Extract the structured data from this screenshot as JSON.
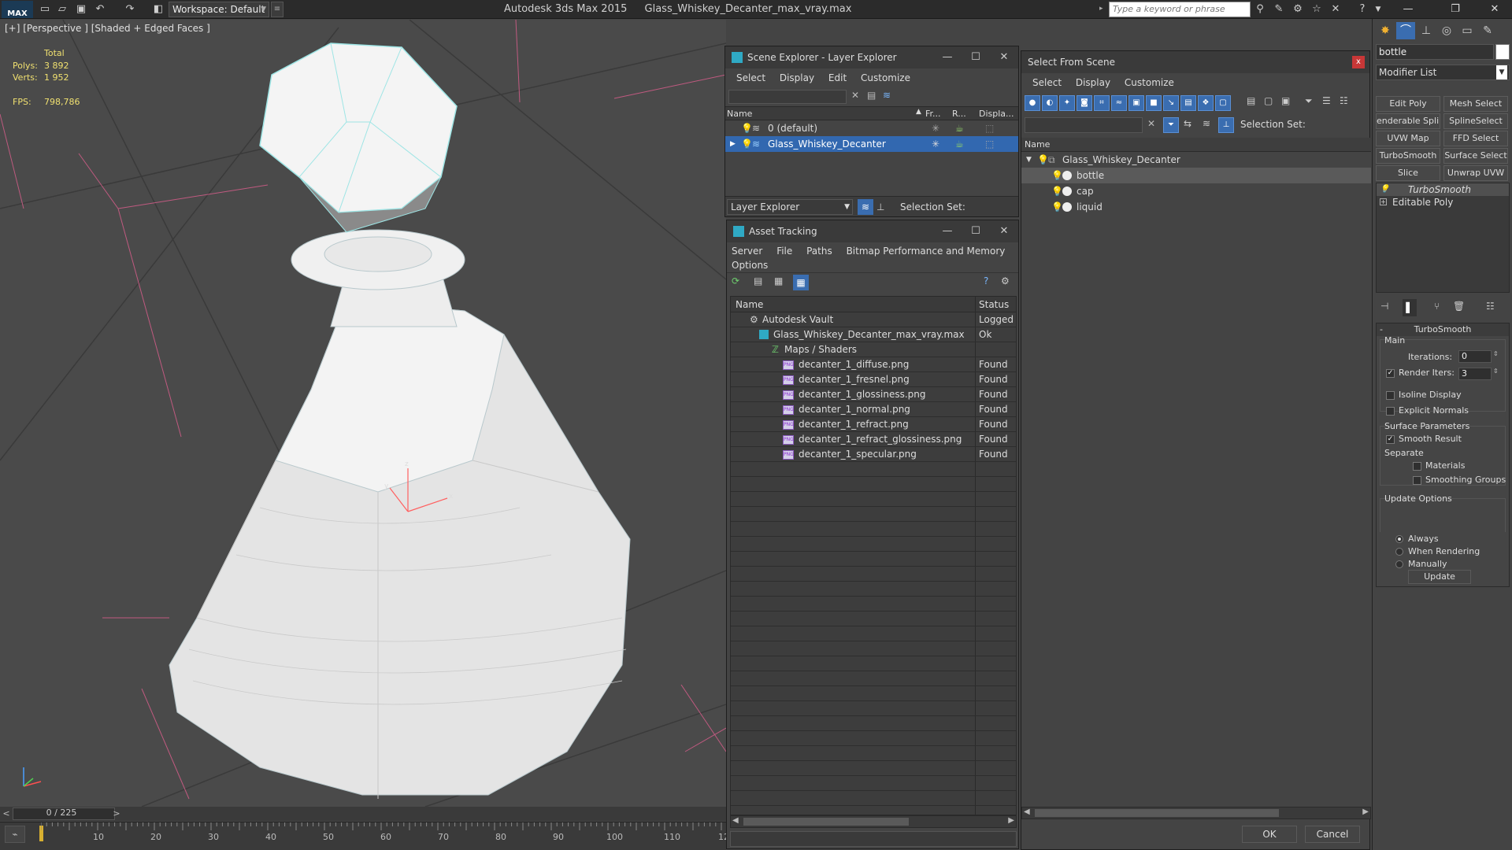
{
  "titlebar": {
    "app_logo": "MAX",
    "workspace": "Workspace: Default",
    "title_app": "Autodesk 3ds Max  2015",
    "title_file": "Glass_Whiskey_Decanter_max_vray.max",
    "search_placeholder": "Type a keyword or phrase"
  },
  "viewport": {
    "label": "[+] [Perspective ] [Shaded + Edged Faces ]",
    "stats": {
      "total_label": "Total",
      "polys_label": "Polys:",
      "polys_value": "3 892",
      "verts_label": "Verts:",
      "verts_value": "1 952",
      "fps_label": "FPS:",
      "fps_value": "798,786"
    },
    "axis": {
      "x": "x",
      "y": "y",
      "z": "z"
    }
  },
  "timeline": {
    "frame_label": "0 / 225",
    "prev": "<",
    "next": ">",
    "ticks": [
      "10",
      "20",
      "30",
      "40",
      "50",
      "60",
      "70",
      "80",
      "90",
      "100",
      "110",
      "12"
    ]
  },
  "scene_explorer": {
    "title": "Scene Explorer - Layer Explorer",
    "menu": [
      "Select",
      "Display",
      "Edit",
      "Customize"
    ],
    "columns": {
      "name": "Name",
      "frozen": "Fr...",
      "render": "R...",
      "display": "Displa..."
    },
    "rows": [
      {
        "label": "0 (default)"
      },
      {
        "label": "Glass_Whiskey_Decanter"
      }
    ],
    "bottom_dropdown": "Layer Explorer",
    "selection_set_label": "Selection Set:"
  },
  "asset_tracking": {
    "title": "Asset Tracking",
    "menu": [
      "Server",
      "File",
      "Paths",
      "Bitmap Performance and Memory",
      "Options"
    ],
    "columns": {
      "name": "Name",
      "status": "Status"
    },
    "rows": [
      {
        "name": "Autodesk Vault",
        "status": "Logged O"
      },
      {
        "name": "Glass_Whiskey_Decanter_max_vray.max",
        "status": "Ok"
      },
      {
        "name": "Maps / Shaders",
        "status": ""
      },
      {
        "name": "decanter_1_diffuse.png",
        "status": "Found"
      },
      {
        "name": "decanter_1_fresnel.png",
        "status": "Found"
      },
      {
        "name": "decanter_1_glossiness.png",
        "status": "Found"
      },
      {
        "name": "decanter_1_normal.png",
        "status": "Found"
      },
      {
        "name": "decanter_1_refract.png",
        "status": "Found"
      },
      {
        "name": "decanter_1_refract_glossiness.png",
        "status": "Found"
      },
      {
        "name": "decanter_1_specular.png",
        "status": "Found"
      }
    ],
    "png_badge": "PNG"
  },
  "select_from_scene": {
    "title": "Select From Scene",
    "close": "x",
    "menu": [
      "Select",
      "Display",
      "Customize"
    ],
    "selection_set_label": "Selection Set:",
    "column_name": "Name",
    "tree": [
      {
        "label": "Glass_Whiskey_Decanter"
      },
      {
        "label": "bottle"
      },
      {
        "label": "cap"
      },
      {
        "label": "liquid"
      }
    ],
    "ok": "OK",
    "cancel": "Cancel"
  },
  "command_panel": {
    "object_name": "bottle",
    "object_color": "#ffffff",
    "modifier_list": "Modifier List",
    "mod_buttons": [
      "Edit Poly",
      "Mesh Select",
      "enderable Splin",
      "SplineSelect",
      "UVW Map",
      "FFD Select",
      "TurboSmooth",
      "Surface Select",
      "Slice",
      "Unwrap UVW"
    ],
    "stack": [
      "TurboSmooth",
      "Editable Poly"
    ],
    "turbosmooth": {
      "header": "TurboSmooth",
      "main": "Main",
      "iterations_label": "Iterations:",
      "iterations": "0",
      "render_iters_label": "Render Iters:",
      "render_iters": "3",
      "render_iters_checked": true,
      "isoline": "Isoline Display",
      "explicit_normals": "Explicit Normals",
      "surface_params": "Surface Parameters",
      "smooth_result": "Smooth Result",
      "separate": "Separate",
      "materials": "Materials",
      "smoothing_groups": "Smoothing Groups",
      "update_options": "Update Options",
      "always": "Always",
      "when_rendering": "When Rendering",
      "manually": "Manually",
      "update": "Update"
    }
  }
}
